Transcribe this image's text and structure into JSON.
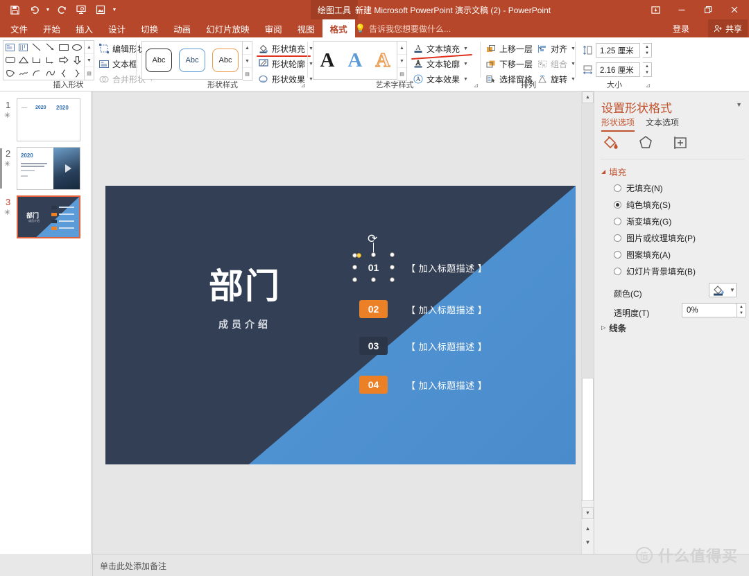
{
  "titlebar": {
    "qat": [
      {
        "name": "save-icon",
        "label": "保存"
      },
      {
        "name": "undo-icon",
        "label": "撤消"
      },
      {
        "name": "redo-icon",
        "label": "恢复"
      },
      {
        "name": "start-slideshow-icon",
        "label": "从头开始"
      },
      {
        "name": "picture-icon",
        "label": "图片"
      },
      {
        "name": "customize-qat-icon",
        "label": "自定义快速访问工具栏"
      }
    ],
    "context_tab": "绘图工具",
    "document_title": "新建 Microsoft PowerPoint 演示文稿 (2) - PowerPoint",
    "window_controls": [
      {
        "name": "ribbon-display-options-icon",
        "glyph": "⊡"
      },
      {
        "name": "minimize-icon",
        "glyph": "—"
      },
      {
        "name": "restore-icon",
        "glyph": "❐"
      },
      {
        "name": "close-icon",
        "glyph": "✕"
      }
    ]
  },
  "tabstrip": {
    "tabs": [
      {
        "label": "文件",
        "active": false
      },
      {
        "label": "开始",
        "active": false
      },
      {
        "label": "插入",
        "active": false
      },
      {
        "label": "设计",
        "active": false
      },
      {
        "label": "切换",
        "active": false
      },
      {
        "label": "动画",
        "active": false
      },
      {
        "label": "幻灯片放映",
        "active": false
      },
      {
        "label": "审阅",
        "active": false
      },
      {
        "label": "视图",
        "active": false
      },
      {
        "label": "格式",
        "active": true
      }
    ],
    "tell_me": "告诉我您想要做什么...",
    "sign_in": "登录",
    "share": "共享"
  },
  "ribbon": {
    "groups": [
      {
        "title": "插入形状"
      },
      {
        "title": "形状样式"
      },
      {
        "title": "艺术字样式"
      },
      {
        "title": "排列"
      },
      {
        "title": "大小"
      }
    ],
    "insert_shapes": {
      "edit_shape": "编辑形状",
      "text_box": "文本框",
      "merge_shapes": "合并形状"
    },
    "shape_styles": {
      "shape_fill": "形状填充",
      "shape_outline": "形状轮廓",
      "shape_effects": "形状效果",
      "sample_text": "Abc"
    },
    "wordart_styles": {
      "text_fill": "文本填充",
      "text_outline": "文本轮廓",
      "text_effects": "文本效果",
      "sample_letter": "A"
    },
    "arrange": {
      "bring_forward": "上移一层",
      "send_backward": "下移一层",
      "selection_pane": "选择窗格",
      "align": "对齐",
      "group": "组合",
      "rotate": "旋转"
    },
    "size": {
      "height_value": "1.25 厘米",
      "width_value": "2.16 厘米"
    }
  },
  "thumbnails": [
    {
      "number": "1",
      "starred": true,
      "selected": false
    },
    {
      "number": "2",
      "starred": true,
      "selected": false,
      "year": "2020"
    },
    {
      "number": "3",
      "starred": true,
      "selected": true
    }
  ],
  "slide": {
    "title": "部门",
    "subtitle": "成员介绍",
    "items": [
      {
        "number": "01",
        "text": "【 加入标题描述 】",
        "badge_color": "#333f54",
        "selected": true
      },
      {
        "number": "02",
        "text": "【 加入标题描述 】",
        "badge_color": "#ec8026",
        "selected": false
      },
      {
        "number": "03",
        "text": "【 加入标题描述 】",
        "badge_color": "#2b3648",
        "selected": false
      },
      {
        "number": "04",
        "text": "【 加入标题描述 】",
        "badge_color": "#ec8026",
        "selected": false
      }
    ],
    "colors": {
      "dark_panel": "#333f54",
      "blue_panel": "#5b9bd8",
      "accent_orange": "#ec8026"
    }
  },
  "notes": {
    "placeholder": "单击此处添加备注"
  },
  "format_pane": {
    "title": "设置形状格式",
    "tabs": [
      {
        "label": "形状选项",
        "active": true
      },
      {
        "label": "文本选项",
        "active": false
      }
    ],
    "icon_tabs": [
      {
        "name": "fill-line-icon"
      },
      {
        "name": "effects-icon"
      },
      {
        "name": "size-properties-icon"
      }
    ],
    "fill_section": {
      "title": "填充",
      "options": [
        {
          "label": "无填充(N)",
          "selected": false
        },
        {
          "label": "纯色填充(S)",
          "selected": true
        },
        {
          "label": "渐变填充(G)",
          "selected": false
        },
        {
          "label": "图片或纹理填充(P)",
          "selected": false
        },
        {
          "label": "图案填充(A)",
          "selected": false
        },
        {
          "label": "幻灯片背景填充(B)",
          "selected": false
        }
      ],
      "color_label": "颜色(C)",
      "transparency_label": "透明度(T)",
      "transparency_value": "0%"
    },
    "line_section": {
      "title": "线条"
    }
  },
  "watermark": {
    "mark": "值",
    "text": "什么值得买"
  }
}
